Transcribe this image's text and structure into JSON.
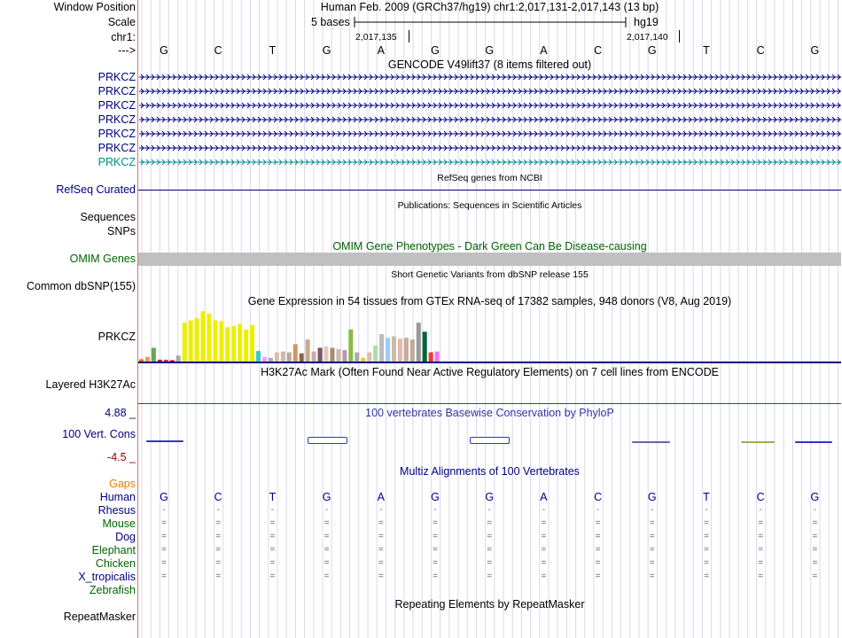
{
  "header": {
    "window_position_label": "Window Position",
    "scale_label": "Scale",
    "chrom_label": "chr1:",
    "strand_label": "--->",
    "assembly_info": "Human Feb. 2009 (GRCh37/hg19)   chr1:2,017,131-2,017,143 (13 bp)",
    "scale_text": "5 bases",
    "scale_db": "hg19",
    "pos_tick_1": "2,017,135",
    "pos_tick_2": "2,017,140"
  },
  "bases": [
    "G",
    "C",
    "T",
    "G",
    "A",
    "G",
    "G",
    "A",
    "C",
    "G",
    "T",
    "C",
    "G"
  ],
  "gencode": {
    "title": "GENCODE V49lift37 (8 items filtered out)",
    "items": [
      "PRKCZ",
      "PRKCZ",
      "PRKCZ",
      "PRKCZ",
      "PRKCZ",
      "PRKCZ",
      "PRKCZ"
    ]
  },
  "refseq": {
    "title": "RefSeq genes from NCBI",
    "label": "RefSeq Curated"
  },
  "publications": {
    "title": "Publications: Sequences in Scientific Articles",
    "label1": "Sequences",
    "label2": "SNPs"
  },
  "omim": {
    "title": "OMIM Gene Phenotypes - Dark Green Can Be Disease-causing",
    "label": "OMIM Genes"
  },
  "dbsnp": {
    "title": "Short Genetic Variants from dbSNP release 155",
    "label": "Common dbSNP(155)"
  },
  "gtex": {
    "title": "Gene Expression in 54 tissues from GTEx RNA-seq of 17382 samples, 948 donors (V8, Aug 2019)",
    "label": "PRKCZ",
    "bars": [
      {
        "v": 5,
        "c": "#ff6600"
      },
      {
        "v": 10,
        "c": "#ff9933"
      },
      {
        "v": 30,
        "c": "#66aa55"
      },
      {
        "v": 4,
        "c": "#993333"
      },
      {
        "v": 4,
        "c": "#cc3366"
      },
      {
        "v": 3,
        "c": "#cc0000"
      },
      {
        "v": 13,
        "c": "#aaaaaa"
      },
      {
        "v": 85,
        "c": "#eeee00"
      },
      {
        "v": 90,
        "c": "#eeee00"
      },
      {
        "v": 95,
        "c": "#eeee00"
      },
      {
        "v": 110,
        "c": "#eeee00"
      },
      {
        "v": 105,
        "c": "#eeee00"
      },
      {
        "v": 90,
        "c": "#eeee00"
      },
      {
        "v": 88,
        "c": "#eeee00"
      },
      {
        "v": 75,
        "c": "#eeee00"
      },
      {
        "v": 78,
        "c": "#eeee00"
      },
      {
        "v": 82,
        "c": "#eeee00"
      },
      {
        "v": 70,
        "c": "#eeee00"
      },
      {
        "v": 80,
        "c": "#eeee00"
      },
      {
        "v": 23,
        "c": "#33cccc"
      },
      {
        "v": 10,
        "c": "#ff99ff"
      },
      {
        "v": 8,
        "c": "#aaaaaa"
      },
      {
        "v": 20,
        "c": "#ddbbaa"
      },
      {
        "v": 22,
        "c": "#ccbbaa"
      },
      {
        "v": 20,
        "c": "#bbaa99"
      },
      {
        "v": 38,
        "c": "#cc9966"
      },
      {
        "v": 18,
        "c": "#886644"
      },
      {
        "v": 48,
        "c": "#ccaa88"
      },
      {
        "v": 22,
        "c": "#ccaaaa"
      },
      {
        "v": 30,
        "c": "#775566"
      },
      {
        "v": 33,
        "c": "#ddccbb"
      },
      {
        "v": 30,
        "c": "#aa8877"
      },
      {
        "v": 27,
        "c": "#ccbbaa"
      },
      {
        "v": 25,
        "c": "#bb99aa"
      },
      {
        "v": 70,
        "c": "#88bb44"
      },
      {
        "v": 20,
        "c": "#aaaaaa"
      },
      {
        "v": 8,
        "c": "#eecc00"
      },
      {
        "v": 20,
        "c": "#ddbbaa"
      },
      {
        "v": 35,
        "c": "#aaddaa"
      },
      {
        "v": 60,
        "c": "#bbbbbb"
      },
      {
        "v": 52,
        "c": "#99ccff"
      },
      {
        "v": 55,
        "c": "#ccbbaa"
      },
      {
        "v": 50,
        "c": "#ddbbaa"
      },
      {
        "v": 52,
        "c": "#ccaa99"
      },
      {
        "v": 48,
        "c": "#bbaa99"
      },
      {
        "v": 85,
        "c": "#999999"
      },
      {
        "v": 65,
        "c": "#006633"
      },
      {
        "v": 20,
        "c": "#ff3333"
      },
      {
        "v": 22,
        "c": "#ee77ee"
      }
    ],
    "bar_max": 120
  },
  "h3k27ac": {
    "title": "H3K27Ac Mark (Often Found Near Active Regulatory Elements) on 7 cell lines from ENCODE",
    "label": "Layered H3K27Ac"
  },
  "conservation": {
    "title": "100 vertebrates Basewise Conservation by PhyloP",
    "label": "100 Vert. Cons",
    "max_label": "4.88 _",
    "min_label": "-4.5 _"
  },
  "multiz": {
    "title": "Multiz Alignments of 100 Vertebrates",
    "gaps_label": "Gaps",
    "species": [
      {
        "name": "Human",
        "color": "#000080"
      },
      {
        "name": "Rhesus",
        "color": "#000080"
      },
      {
        "name": "Mouse",
        "color": "#006400"
      },
      {
        "name": "Dog",
        "color": "#000080"
      },
      {
        "name": "Elephant",
        "color": "#006400"
      },
      {
        "name": "Chicken",
        "color": "#006400"
      },
      {
        "name": "X_tropicalis",
        "color": "#000080"
      },
      {
        "name": "Zebrafish",
        "color": "#006400"
      }
    ],
    "rhesus_char": "-",
    "eq_char": "="
  },
  "repeatmasker": {
    "title": "Repeating Elements by RepeatMasker",
    "label": "RepeatMasker"
  },
  "colors": {
    "navy": "#000080",
    "omim_green": "#006400",
    "brown": "#8b0000",
    "cyan_gene": "#008b8b",
    "cons_blue": "#3333cc"
  }
}
